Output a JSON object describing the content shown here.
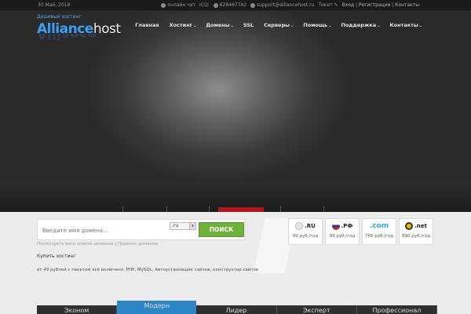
{
  "topbar": {
    "date": "30 Май, 2018",
    "chat": "онлайн чат",
    "icq_label": "ICQ:",
    "icq_number": "628467742",
    "email": "support@alliancehost.ru",
    "ticket": "Тикет",
    "login": "Вход",
    "register": "Регистрация",
    "contacts": "Контакты"
  },
  "logo": {
    "tagline": "Дешевый хостинг",
    "name_part1": "Alliance",
    "name_part2": "host"
  },
  "nav": {
    "items": [
      {
        "label": "Главная",
        "dropdown": ""
      },
      {
        "label": "Хостинг",
        "dropdown": "⌄"
      },
      {
        "label": "Домены",
        "dropdown": "⌄"
      },
      {
        "label": "SSL",
        "dropdown": ""
      },
      {
        "label": "Серверы",
        "dropdown": "⌄"
      },
      {
        "label": "Помощь",
        "dropdown": "⌄"
      },
      {
        "label": "Поддержка",
        "dropdown": "⌄"
      },
      {
        "label": "Контакты",
        "dropdown": "⌄"
      }
    ]
  },
  "domain_search": {
    "placeholder": "Введите имя домена...",
    "zone_selected": ".ru",
    "button": "ПОИСК",
    "links_all": "Посмотреть весь список доменов",
    "links_sep": "|",
    "links_transfer": "Перенос доменов"
  },
  "zones": [
    {
      "name": ".RU",
      "price": "99 руб./год",
      "color": "#cfcfcf"
    },
    {
      "name": ".РФ",
      "price": "99 руб./год",
      "color": "#c8262c"
    },
    {
      "name": ".com",
      "price": "765 руб./год",
      "color": "#2aa9e0"
    },
    {
      "name": ".net",
      "price": "890 руб./год",
      "color": "#f0b400"
    }
  ],
  "hosting": {
    "title": "Купить хостинг",
    "description": "от 49 рублей с пакетом всё включено: PHP, MySQL, Автоустановщик сайтов, конструктор сайтов"
  },
  "plans": {
    "tabs": [
      "Эконом",
      "Модерн",
      "Лидер",
      "Эксперт",
      "Профессионал"
    ],
    "active": "Модерн"
  },
  "colors": {
    "accent": "#3aa0f0",
    "search_button": "#6fb13b",
    "active_tab": "#2d86c5"
  }
}
